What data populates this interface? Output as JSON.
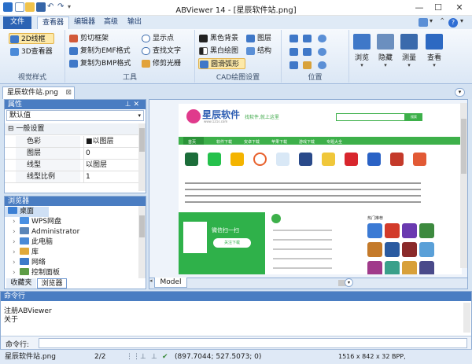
{
  "window": {
    "title": "ABViewer 14 - [星辰软件站.png]",
    "minimize": "—",
    "maximize": "☐",
    "close": "✕"
  },
  "ribbon_tabs": [
    "文件",
    "查看器",
    "编辑器",
    "高级",
    "输出"
  ],
  "ribbon_right": {
    "dropdown": "▾",
    "help": "?"
  },
  "groups": {
    "view_style": {
      "label": "视觉样式",
      "btn_2d": "2D线框",
      "btn_3d": "3D查看器"
    },
    "tools": {
      "label": "工具",
      "cut_frame": "剪切框架",
      "copy_emf": "复制为EMF格式",
      "copy_bmp": "复制为BMP格式",
      "show_points": "显示点",
      "find_text": "查找文字",
      "trim_raster": "修剪光栅"
    },
    "cad_settings": {
      "label": "CAD绘图设置",
      "black_bg": "黑色背景",
      "bw_draw": "黑白绘图",
      "smooth_arc": "圆滑弧形",
      "layers": "图层",
      "structure": "结构"
    },
    "position": {
      "label": "位置"
    },
    "big_buttons": {
      "browse": "浏览",
      "hide": "隐藏",
      "measure": "测量",
      "viewer": "查看"
    }
  },
  "doc_tab": {
    "name": "星辰软件站.png",
    "close": "⊠"
  },
  "properties": {
    "title": "属性",
    "pin": "⊥ ✕",
    "dropdown_value": "默认值",
    "section": "一般设置",
    "rows": [
      {
        "name": "色彩",
        "value": "■以图层"
      },
      {
        "name": "图层",
        "value": "0"
      },
      {
        "name": "线型",
        "value": "以图层"
      },
      {
        "name": "线型比例",
        "value": "1"
      }
    ]
  },
  "browser": {
    "title": "浏览器",
    "items": [
      {
        "label": "桌面",
        "icon": "desktop-icon",
        "color": "#3b7fd4"
      },
      {
        "label": "WPS网盘",
        "icon": "cloud-icon",
        "color": "#4a90e2"
      },
      {
        "label": "Administrator",
        "icon": "user-icon",
        "color": "#5b86b8"
      },
      {
        "label": "此电脑",
        "icon": "computer-icon",
        "color": "#4a8ad6"
      },
      {
        "label": "库",
        "icon": "library-icon",
        "color": "#e0a93b"
      },
      {
        "label": "网络",
        "icon": "network-icon",
        "color": "#3d7bc9"
      },
      {
        "label": "控制面板",
        "icon": "control-panel-icon",
        "color": "#5d9c45"
      }
    ],
    "tabs": [
      "收藏夹",
      "浏览器"
    ]
  },
  "viewer": {
    "model_tab": "Model",
    "site_logo": "星辰软件",
    "site_url": "www.121s.com",
    "site_slogan": "找软件,就上这里",
    "search_btn": "搜索",
    "nav": [
      "首页",
      "软件下载",
      "安卓下载",
      "苹果下载",
      "游戏下载",
      "专题大全"
    ],
    "wechat_title": "微信扫一扫",
    "wechat_btn": "关注下载",
    "hot_title": "热门推荐"
  },
  "command": {
    "title": "命令行",
    "lines": [
      "注册ABViewer",
      "关于"
    ],
    "prompt": "命令行:"
  },
  "status": {
    "file": "星辰软件站.png",
    "page": "2/2",
    "coords": "(897.7044; 527.5073; 0)",
    "size": "1516 x 842 x 32 BPP,"
  }
}
